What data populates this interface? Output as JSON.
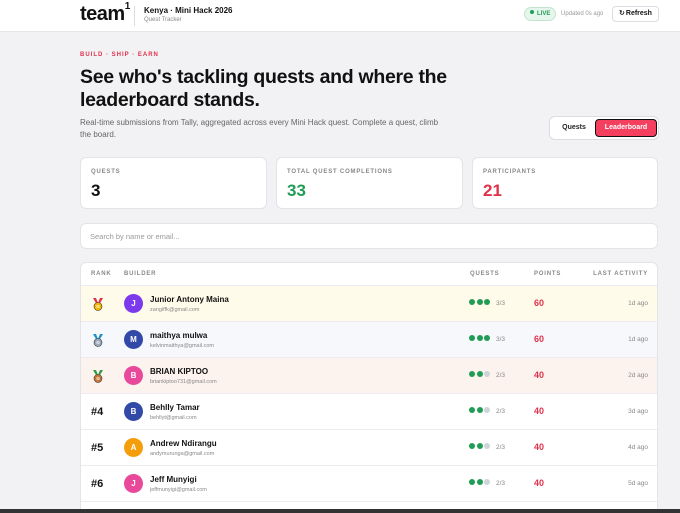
{
  "header": {
    "logo": "team",
    "logo_sup": "1",
    "event_title": "Kenya · Mini Hack 2026",
    "event_subtitle": "Quest Tracker",
    "live_label": "LIVE",
    "updated_text": "Updated 0s ago",
    "refresh_label": "Refresh"
  },
  "hero": {
    "eyebrow": "BUILD · SHIP · EARN",
    "headline": "See who's tackling quests and where the leaderboard stands.",
    "subtext": "Real-time submissions from Tally, aggregated across every Mini Hack quest. Complete a quest, climb the board."
  },
  "view_toggle": {
    "quests": "Quests",
    "leaderboard": "Leaderboard",
    "active": "leaderboard"
  },
  "stats": [
    {
      "label": "QUESTS",
      "value": "3",
      "color": "#111111"
    },
    {
      "label": "TOTAL QUEST COMPLETIONS",
      "value": "33",
      "color": "#1f9d55"
    },
    {
      "label": "PARTICIPANTS",
      "value": "21",
      "color": "#e0314b"
    }
  ],
  "search": {
    "placeholder": "Search by name or email..."
  },
  "table": {
    "columns": {
      "rank": "RANK",
      "builder": "BUILDER",
      "quests": "QUESTS",
      "points": "POINTS",
      "last_activity": "LAST ACTIVITY"
    },
    "rows": [
      {
        "rank": "",
        "medal": "gold-medal-icon",
        "initial": "J",
        "avatar_color": "#7c3aed",
        "name": "Junior Antony Maina",
        "email": "zangiffk@gmail.com",
        "completed": 3,
        "total": 3,
        "quests": "3/3",
        "points": "60",
        "last": "1d ago",
        "bg": "#fffbea"
      },
      {
        "rank": "",
        "medal": "silver-medal-icon",
        "initial": "M",
        "avatar_color": "#3349a8",
        "name": "maithya mulwa",
        "email": "kelvinmaithya@gmail.com",
        "completed": 3,
        "total": 3,
        "quests": "3/3",
        "points": "60",
        "last": "1d ago",
        "bg": "#f6f8fc"
      },
      {
        "rank": "",
        "medal": "bronze-medal-icon",
        "initial": "B",
        "avatar_color": "#e8499a",
        "name": "BRIAN KIPTOO",
        "email": "briankiptoo731@gmail.com",
        "completed": 2,
        "total": 3,
        "quests": "2/3",
        "points": "40",
        "last": "2d ago",
        "bg": "#fdf3ee"
      },
      {
        "rank": "#4",
        "medal": "",
        "initial": "B",
        "avatar_color": "#3349a8",
        "name": "Behlly Tamar",
        "email": "behllyt@gmail.com",
        "completed": 2,
        "total": 3,
        "quests": "2/3",
        "points": "40",
        "last": "3d ago",
        "bg": "#ffffff"
      },
      {
        "rank": "#5",
        "medal": "",
        "initial": "A",
        "avatar_color": "#f59e0b",
        "name": "Andrew Ndirangu",
        "email": "andymurunga@gmail.com",
        "completed": 2,
        "total": 3,
        "quests": "2/3",
        "points": "40",
        "last": "4d ago",
        "bg": "#ffffff"
      },
      {
        "rank": "#6",
        "medal": "",
        "initial": "J",
        "avatar_color": "#e8499a",
        "name": "Jeff Munyigi",
        "email": "jeffmunyigi@gmail.com",
        "completed": 2,
        "total": 3,
        "quests": "2/3",
        "points": "40",
        "last": "5d ago",
        "bg": "#ffffff"
      }
    ]
  },
  "colors": {
    "accent_red": "#e0314b",
    "leaderboard_button": "#f43f5e",
    "green": "#1f9d55",
    "dot_empty": "#cfd3da"
  }
}
